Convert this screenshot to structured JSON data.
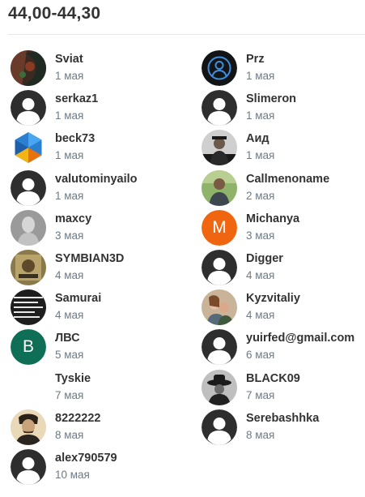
{
  "title": "44,00-44,30",
  "users": [
    {
      "name": "Sviat",
      "date": "1 мая",
      "avatar": "photo-tattoo"
    },
    {
      "name": "Prz",
      "date": "1 мая",
      "avatar": "person-circle-icon"
    },
    {
      "name": "serkaz1",
      "date": "1 мая",
      "avatar": "default-user-icon"
    },
    {
      "name": "Slimeron",
      "date": "1 мая",
      "avatar": "default-user-icon"
    },
    {
      "name": "beck73",
      "date": "1 мая",
      "avatar": "hexagon-logo"
    },
    {
      "name": "Аид",
      "date": "1 мая",
      "avatar": "photo-person-dark"
    },
    {
      "name": "valutominyailo",
      "date": "1 мая",
      "avatar": "default-user-icon"
    },
    {
      "name": "Callmenoname",
      "date": "2 мая",
      "avatar": "photo-person-outdoor"
    },
    {
      "name": "maxcy",
      "date": "3 мая",
      "avatar": "photo-statue"
    },
    {
      "name": "Michanya",
      "date": "3 мая",
      "avatar": "letter",
      "letter": "M",
      "color": "#f0650f"
    },
    {
      "name": "SYMBIAN3D",
      "date": "4 мая",
      "avatar": "photo-poster"
    },
    {
      "name": "Digger",
      "date": "4 мая",
      "avatar": "default-user-icon"
    },
    {
      "name": "Samurai",
      "date": "4 мая",
      "avatar": "photo-text-collage"
    },
    {
      "name": "Kyzvitaliy",
      "date": "4 мая",
      "avatar": "photo-couple"
    },
    {
      "name": "ЛВС",
      "date": "5 мая",
      "avatar": "letter",
      "letter": "B",
      "color": "#0f6e56"
    },
    {
      "name": "yuirfed@gmail.com",
      "date": "6 мая",
      "avatar": "default-user-icon"
    },
    {
      "name": "Tyskie",
      "date": "7 мая",
      "avatar": "none"
    },
    {
      "name": "BLACK09",
      "date": "7 мая",
      "avatar": "photo-bw-hat"
    },
    {
      "name": "8222222",
      "date": "8 мая",
      "avatar": "photo-tesla"
    },
    {
      "name": "Serebashhka",
      "date": "8 мая",
      "avatar": "default-user-icon"
    },
    {
      "name": "alex790579",
      "date": "10 мая",
      "avatar": "default-user-icon"
    }
  ]
}
